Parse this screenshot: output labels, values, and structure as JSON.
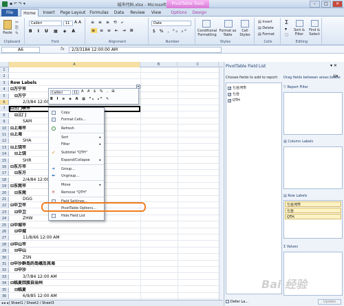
{
  "window": {
    "title": "城市代码.xlsx - Microsoft Excel",
    "contextual_tab": "PivotTable Tools",
    "min": "–",
    "max": "□",
    "close": "✕"
  },
  "tabs": [
    "File",
    "Home",
    "Insert",
    "Page Layout",
    "Formulas",
    "Data",
    "Review",
    "View",
    "Options",
    "Design"
  ],
  "ribbon": {
    "clipboard": {
      "paste": "Paste",
      "label": "Clipboard"
    },
    "font": {
      "name": "Calibri",
      "size": "11",
      "label": "Font"
    },
    "alignment": {
      "label": "Alignment"
    },
    "number": {
      "format": "Date",
      "label": "Number"
    },
    "styles": {
      "conditional": "Conditional Formatting",
      "format_table": "Format as Table",
      "cell_styles": "Cell Styles",
      "label": "Styles"
    },
    "cells": {
      "insert": "Insert",
      "delete": "Delete",
      "format": "Format",
      "label": "Cells"
    },
    "editing": {
      "sum": "Σ",
      "sort": "Sort & Filter",
      "find": "Find & Select",
      "label": "Editing"
    }
  },
  "formula": {
    "name_box": "A6",
    "fx": "fx",
    "value": "2/3/3184 12:00:00 AM"
  },
  "columns": [
    "A",
    "B",
    "C"
  ],
  "rows": [
    {
      "n": "1",
      "a": ""
    },
    {
      "n": "2",
      "a": ""
    },
    {
      "n": "3",
      "a": "Row Labels"
    },
    {
      "n": "4",
      "a": "⊟万宁市"
    },
    {
      "n": "5",
      "a": "⊟万宁"
    },
    {
      "n": "6",
      "a": "2/3/84 12:00 AM"
    },
    {
      "n": "7",
      "a": "⊟三门峡市"
    },
    {
      "n": "8",
      "a": "⊟三门"
    },
    {
      "n": "9",
      "a": "SAM"
    },
    {
      "n": "10",
      "a": "⊟上海市"
    },
    {
      "n": "11",
      "a": "⊟上海"
    },
    {
      "n": "12",
      "a": "SHA"
    },
    {
      "n": "13",
      "a": "⊟上饶市"
    },
    {
      "n": "14",
      "a": "⊟上饶"
    },
    {
      "n": "15",
      "a": "SHR"
    },
    {
      "n": "16",
      "a": "⊟东方市"
    },
    {
      "n": "17",
      "a": "⊟东方"
    },
    {
      "n": "18",
      "a": "2/4/84 12:00 AM"
    },
    {
      "n": "19",
      "a": "⊟东莞市"
    },
    {
      "n": "20",
      "a": "⊟东莞"
    },
    {
      "n": "21",
      "a": "DGG"
    },
    {
      "n": "22",
      "a": "⊟中卫市"
    },
    {
      "n": "23",
      "a": "⊟中卫"
    },
    {
      "n": "24",
      "a": "ZHW"
    },
    {
      "n": "25",
      "a": "⊟中城市"
    },
    {
      "n": "26",
      "a": "⊟中城"
    },
    {
      "n": "27",
      "a": "11/8/66 12:00 AM"
    },
    {
      "n": "28",
      "a": "⊟中山市"
    },
    {
      "n": "29",
      "a": "⊟中山"
    },
    {
      "n": "30",
      "a": "ZSN"
    },
    {
      "n": "31",
      "a": "⊟中沙群岛的岛礁及其海"
    },
    {
      "n": "32",
      "a": "⊟中沙"
    },
    {
      "n": "33",
      "a": "3/7/84 12:00 AM"
    },
    {
      "n": "34",
      "a": "⊟临夏回族自治州"
    },
    {
      "n": "35",
      "a": "⊟临夏"
    },
    {
      "n": "36",
      "a": "6/9/85 12:00 AM"
    }
  ],
  "minitoolbar": {
    "font": "Calibri",
    "size": "11"
  },
  "context_menu": [
    {
      "label": "Copy",
      "sub": false
    },
    {
      "label": "Format Cells...",
      "sub": false
    },
    {
      "label": "Refresh",
      "sub": false
    },
    {
      "label": "Sort",
      "sub": true
    },
    {
      "label": "Filter",
      "sub": true
    },
    {
      "label": "Subtotal \"QTH\"",
      "sub": false
    },
    {
      "label": "Expand/Collapse",
      "sub": true
    },
    {
      "label": "Group...",
      "sub": false
    },
    {
      "label": "Ungroup...",
      "sub": false
    },
    {
      "label": "Move",
      "sub": true
    },
    {
      "label": "Remove \"QTH\"",
      "sub": false
    },
    {
      "label": "Field Settings...",
      "sub": false
    },
    {
      "label": "PivotTable Options...",
      "sub": false
    },
    {
      "label": "Hide Field List",
      "sub": false
    }
  ],
  "sheet_tabs": "◂ ▸ ▸| Sheet1 / Sheet2 / Sheet3",
  "field_list": {
    "title": "PivotTable Field List",
    "choose": "Choose fields to add to report:",
    "fields": [
      "七台河市",
      "七台",
      "QTH"
    ],
    "drag_label": "Drag fields between areas below:",
    "report_filter": "Report Filter",
    "column_labels": "Column Labels",
    "row_labels": "Row Labels",
    "row_items": [
      "七台河市",
      "七台",
      "QTH"
    ],
    "values": "Values",
    "defer": "Defer La...",
    "update": "Update"
  },
  "watermark": "Bai 经验"
}
